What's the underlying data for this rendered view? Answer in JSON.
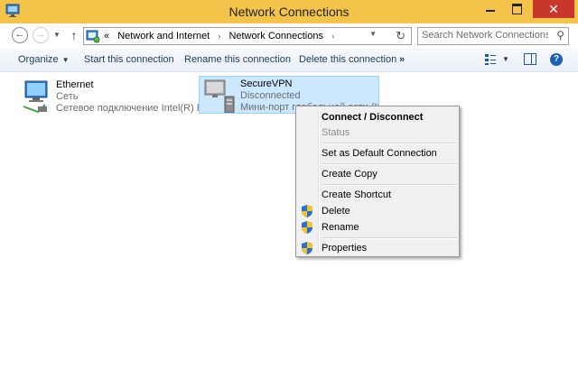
{
  "window": {
    "title": "Network Connections",
    "close_glyph": "✕"
  },
  "nav": {
    "back_glyph": "←",
    "forward_glyph": "→",
    "up_glyph": "↑"
  },
  "address": {
    "prefix": "«",
    "crumbs": [
      "Network and Internet",
      "Network Connections"
    ],
    "separator": "›"
  },
  "search": {
    "placeholder": "Search Network Connections"
  },
  "commandbar": {
    "organize": "Organize",
    "start": "Start this connection",
    "rename": "Rename this connection",
    "delete": "Delete this connection",
    "more": "»"
  },
  "connections": [
    {
      "name": "Ethernet",
      "status": "Сеть",
      "device": "Сетевое подключение Intel(R) P..."
    },
    {
      "name": "SecureVPN",
      "status": "Disconnected",
      "device": "Мини-порт глобальной сети (IK..."
    }
  ],
  "context_menu": {
    "items": [
      {
        "label": "Connect / Disconnect",
        "bold": true
      },
      {
        "label": "Status",
        "disabled": true
      },
      {
        "label": "Set as Default Connection"
      },
      {
        "label": "Create Copy"
      },
      {
        "label": "Create Shortcut"
      },
      {
        "label": "Delete",
        "icon": "uac-shield-icon"
      },
      {
        "label": "Rename",
        "icon": "uac-shield-icon"
      },
      {
        "label": "Properties",
        "icon": "uac-shield-icon"
      }
    ]
  },
  "colors": {
    "titlebar": "#f4c44a",
    "close": "#c7382b",
    "selection": "#cce8ff",
    "link_text": "#1e395b"
  }
}
